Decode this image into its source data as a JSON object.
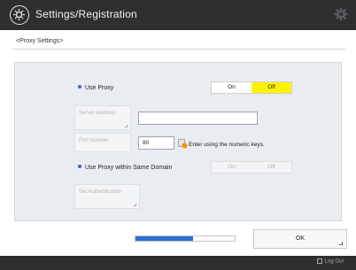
{
  "header": {
    "title": "Settings/Registration"
  },
  "breadcrumb": "<Proxy Settings>",
  "settings": {
    "use_proxy": {
      "label": "Use Proxy",
      "on": "On",
      "off": "Off",
      "selected": "Off"
    },
    "server_address": {
      "button": "Server Address",
      "value": ""
    },
    "port_number": {
      "button": "Port Number",
      "value": "80",
      "hint": "Enter using the numeric keys."
    },
    "same_domain": {
      "label": "Use Proxy within Same Domain",
      "on": "On",
      "off": "Off"
    },
    "authentication": {
      "button": "Set Authentication"
    }
  },
  "progress": {
    "fraction": 0.58
  },
  "actions": {
    "ok": "OK"
  },
  "footer": {
    "logout": "Log Out"
  },
  "colors": {
    "accent": "#2f6fd6",
    "selected_toggle": "#fff200",
    "titlebar": "#2e2f31"
  }
}
